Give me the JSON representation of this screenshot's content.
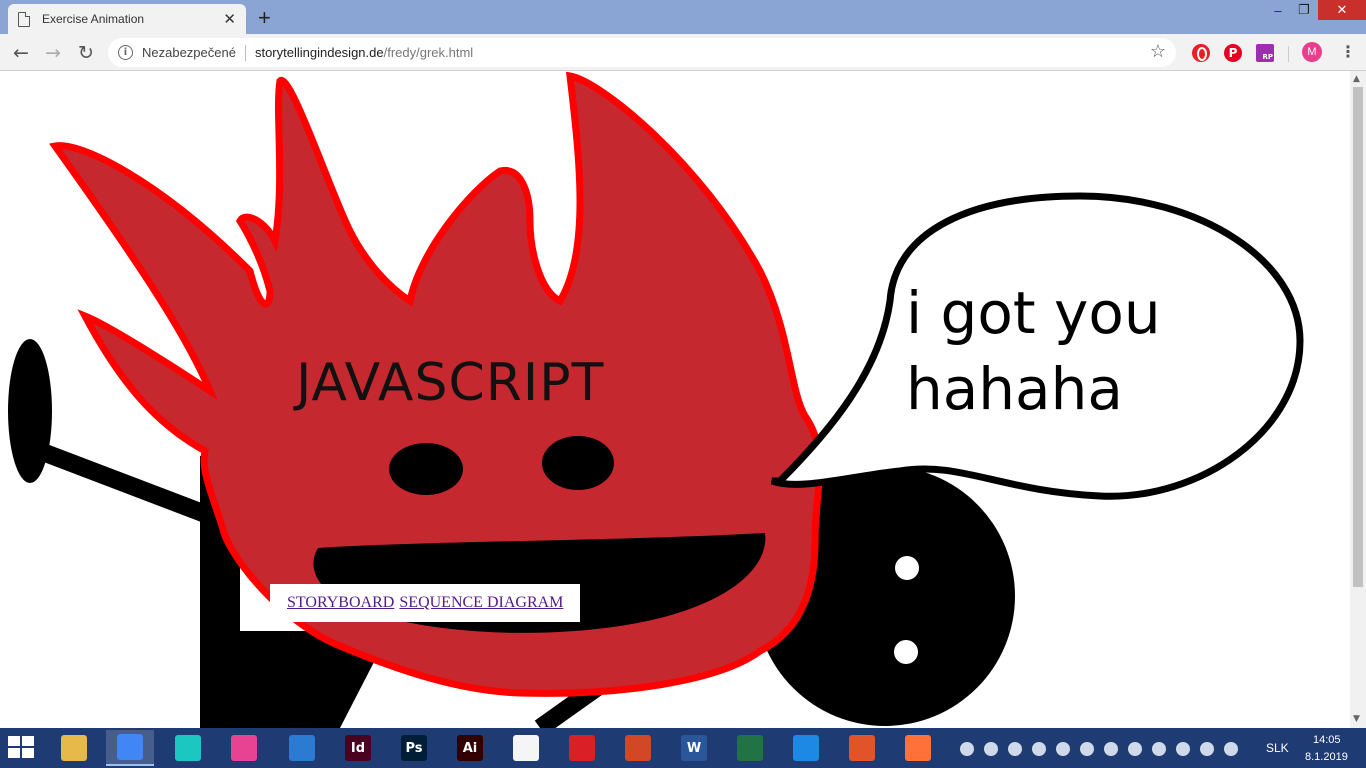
{
  "browser": {
    "tab_title": "Exercise Animation",
    "tab_close": "✕",
    "new_tab": "+",
    "window_controls": {
      "minimize": "–",
      "maximize": "❐",
      "close": "✕"
    },
    "nav": {
      "back": "←",
      "forward": "→",
      "reload": "↻"
    },
    "security_text": "Nezabezpečené",
    "url_host": "storytellingindesign.de",
    "url_path": "/fredy/grek.html",
    "star": "☆",
    "extensions": [
      "opera-icon",
      "pinterest-icon",
      "rp-icon"
    ],
    "pinterest_glyph": "P",
    "rp_glyph": "RP",
    "profile_initial": "M",
    "menu": "⋮"
  },
  "page": {
    "character_label": "JAVASCRIPT",
    "speech_line1": "i got you",
    "speech_line2": "hahaha",
    "links": [
      {
        "label": "STORYBOARD"
      },
      {
        "label": "SEQUENCE DIAGRAM"
      }
    ],
    "colors": {
      "flame_fill": "#c5282f",
      "flame_outline": "#ff0000",
      "ink": "#000000",
      "link": "#551a8b"
    }
  },
  "taskbar": {
    "apps": [
      {
        "icon": "file-explorer-icon",
        "glyph": "",
        "color": "#e7b84a"
      },
      {
        "icon": "chrome-icon",
        "glyph": "",
        "color": "#4285f4",
        "active": true
      },
      {
        "icon": "app-teal-icon",
        "glyph": "",
        "color": "#1cc7c1"
      },
      {
        "icon": "app-color-icon",
        "glyph": "",
        "color": "#e84393"
      },
      {
        "icon": "vscode-icon",
        "glyph": "",
        "color": "#2b7bd3"
      },
      {
        "icon": "indesign-icon",
        "glyph": "Id",
        "color": "#49021f"
      },
      {
        "icon": "photoshop-icon",
        "glyph": "Ps",
        "color": "#001e36"
      },
      {
        "icon": "illustrator-icon",
        "glyph": "Ai",
        "color": "#330000"
      },
      {
        "icon": "document-icon",
        "glyph": "",
        "color": "#f5f5f5"
      },
      {
        "icon": "creative-cloud-icon",
        "glyph": "",
        "color": "#da1f26"
      },
      {
        "icon": "powerpoint-icon",
        "glyph": "",
        "color": "#d24726"
      },
      {
        "icon": "word-icon",
        "glyph": "W",
        "color": "#2b579a"
      },
      {
        "icon": "excel-icon",
        "glyph": "",
        "color": "#217346"
      },
      {
        "icon": "sync-icon",
        "glyph": "",
        "color": "#1e88e5"
      },
      {
        "icon": "app-orange-icon",
        "glyph": "",
        "color": "#e1542a"
      },
      {
        "icon": "firefox-icon",
        "glyph": "",
        "color": "#ff7139"
      }
    ],
    "language": "SLK",
    "time": "14:05",
    "date": "8.1.2019"
  }
}
